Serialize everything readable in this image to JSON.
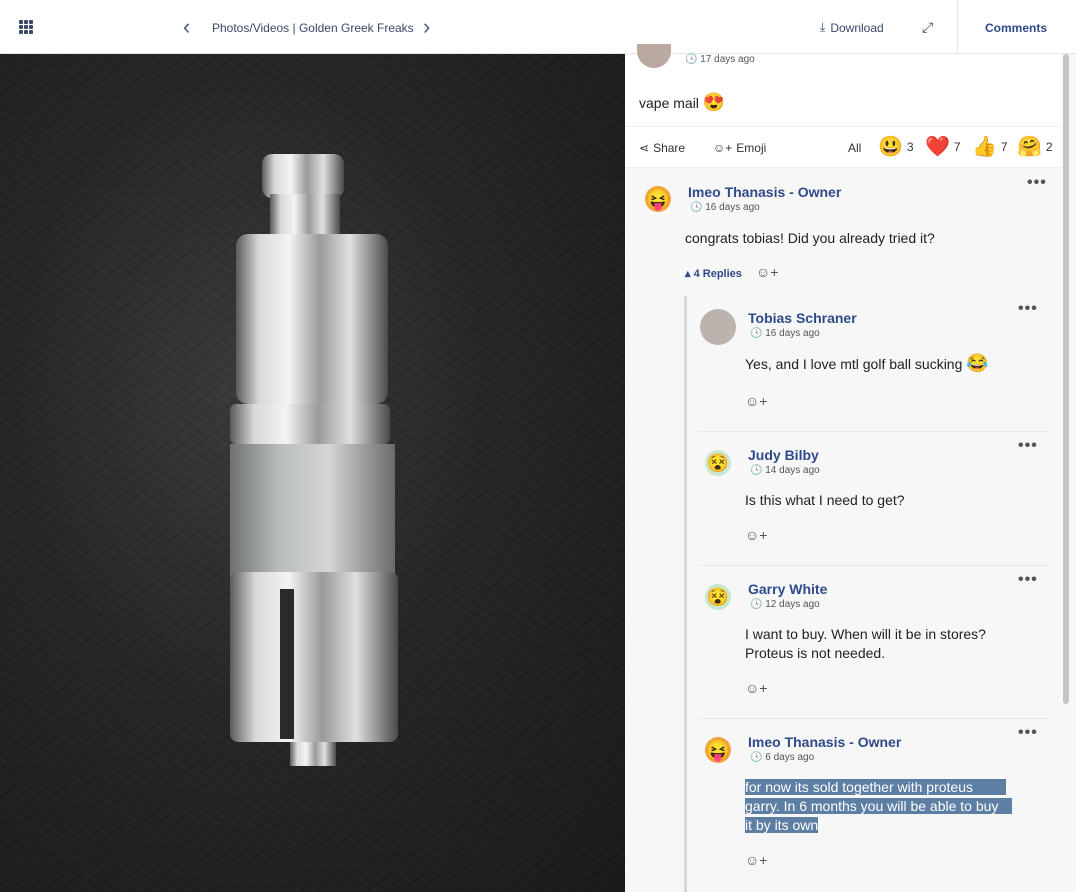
{
  "header": {
    "grid_icon": "apps-grid-icon",
    "breadcrumb": "Photos/Videos | Golden Greek Freaks",
    "download_label": "Download",
    "comments_label": "Comments"
  },
  "post": {
    "time": "17 days ago",
    "text": "vape mail",
    "text_emoji": "😍",
    "share_label": "Share",
    "emoji_label": "Emoji",
    "all_label": "All",
    "reactions": [
      {
        "emoji": "😃",
        "count": "3"
      },
      {
        "emoji": "❤️",
        "count": "7"
      },
      {
        "emoji": "👍",
        "count": "7"
      },
      {
        "emoji": "🤗",
        "count": "2"
      }
    ]
  },
  "comment": {
    "author": "Imeo Thanasis - Owner",
    "time": "16 days ago",
    "text": "congrats tobias! Did you already tried it?",
    "replies_label": "4 Replies"
  },
  "replies": [
    {
      "author": "Tobias Schraner",
      "time": "16 days ago",
      "text": "Yes, and I love mtl golf ball sucking",
      "emoji": "😂"
    },
    {
      "author": "Judy Bilby",
      "time": "14 days ago",
      "text": "Is this what I need to get?"
    },
    {
      "author": "Garry White",
      "time": "12 days ago",
      "text_line1": "I want to buy. When will it be in stores?",
      "text_line2": "Proteus is not needed."
    },
    {
      "author": "Imeo Thanasis - Owner",
      "time": "6 days ago",
      "text_line1": "for now its sold together with proteus",
      "text_line2": "garry. In 6 months you will be able to buy",
      "text_line3": "it by its own"
    }
  ],
  "icons": {
    "clock": "🕓",
    "emoji_add": "☺+",
    "more": "•••"
  }
}
